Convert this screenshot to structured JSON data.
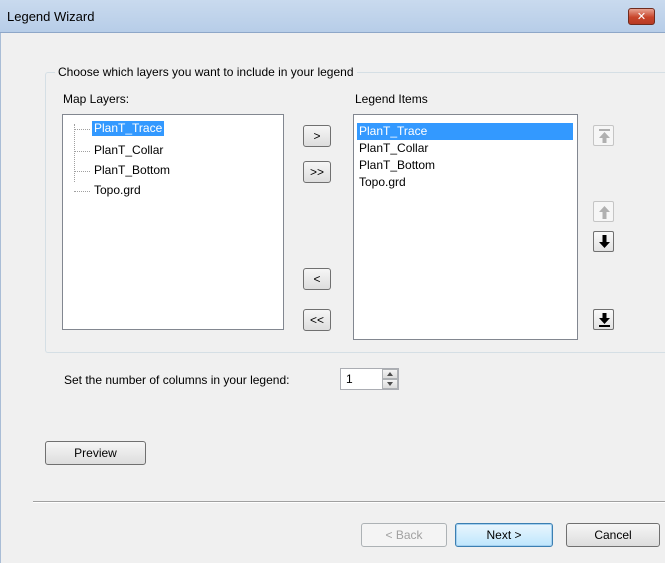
{
  "window": {
    "title": "Legend Wizard",
    "close_symbol": "✕"
  },
  "group": {
    "legend": "Choose which layers you want to include in your legend"
  },
  "map_layers": {
    "label": "Map Layers:",
    "items": [
      "PlanT_Trace",
      "PlanT_Collar",
      "PlanT_Bottom",
      "Topo.grd"
    ],
    "selected_index": 0
  },
  "legend_items": {
    "label": "Legend Items",
    "items": [
      "PlanT_Trace",
      "PlanT_Collar",
      "PlanT_Bottom",
      "Topo.grd"
    ],
    "selected_index": 0
  },
  "transfer_buttons": {
    "add": ">",
    "add_all": ">>",
    "remove": "<",
    "remove_all": "<<"
  },
  "order_buttons": {
    "move_top_icon": "arrow-to-top-icon",
    "move_up_icon": "arrow-up-icon",
    "move_down_icon": "arrow-down-icon",
    "move_bottom_icon": "arrow-to-bottom-icon"
  },
  "columns": {
    "label": "Set the number of columns in your legend:",
    "value": "1"
  },
  "buttons": {
    "preview": "Preview",
    "back": "< Back",
    "next": "Next >",
    "cancel": "Cancel"
  },
  "colors": {
    "selection": "#3399ff",
    "titlebar": "#c9daee",
    "close": "#c8452b"
  }
}
